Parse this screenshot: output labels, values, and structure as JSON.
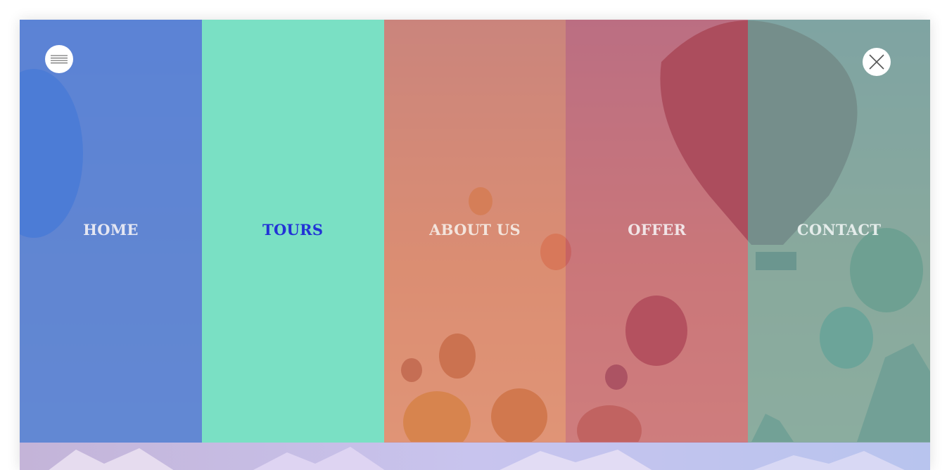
{
  "nav": {
    "items": [
      {
        "label": "HOME",
        "active": false,
        "color": "#e4e6f2"
      },
      {
        "label": "TOURS",
        "active": true,
        "color": "#2233d6"
      },
      {
        "label": "ABOUT US",
        "active": false,
        "color": "#f3e4dc"
      },
      {
        "label": "OFFER",
        "active": false,
        "color": "#f1e4e6"
      },
      {
        "label": "CONTACT",
        "active": false,
        "color": "#e4ecea"
      }
    ]
  },
  "icons": {
    "menu": "hamburger-icon",
    "close": "close-icon"
  },
  "colors": {
    "home_panel": "#4e80da",
    "tours_panel": "#7ae0c4",
    "about_panel": "#d6785a",
    "offer_panel": "#be5868",
    "contact_panel": "#70a69e",
    "active_text": "#2233d6"
  }
}
